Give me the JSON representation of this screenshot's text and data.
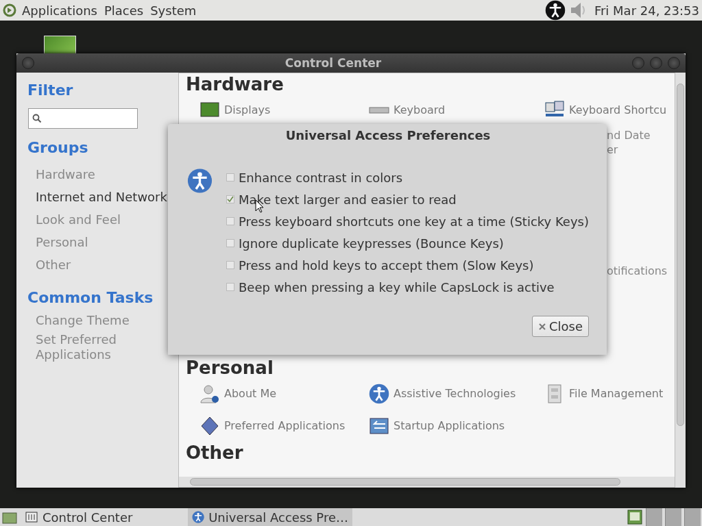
{
  "top_panel": {
    "menus": [
      "Applications",
      "Places",
      "System"
    ],
    "clock": "Fri Mar 24, 23:53"
  },
  "window": {
    "title": "Control Center"
  },
  "sidebar": {
    "filter_heading": "Filter",
    "groups_heading": "Groups",
    "groups": [
      {
        "label": "Hardware",
        "selected": false
      },
      {
        "label": "Internet and Network",
        "selected": true
      },
      {
        "label": "Look and Feel",
        "selected": false
      },
      {
        "label": "Personal",
        "selected": false
      },
      {
        "label": "Other",
        "selected": false
      }
    ],
    "tasks_heading": "Common Tasks",
    "tasks": [
      "Change Theme",
      "Set Preferred Applications"
    ]
  },
  "content": {
    "sections": [
      {
        "title": "Hardware",
        "items": [
          {
            "label": "Displays",
            "kind": "display"
          },
          {
            "label": "Keyboard",
            "kind": "keyboard"
          },
          {
            "label": "Keyboard Shortcu",
            "kind": "shortcuts"
          }
        ],
        "partly_hidden": [
          [
            "nd Date",
            "er"
          ],
          [
            "otifications"
          ]
        ]
      },
      {
        "title": "Personal",
        "items": [
          {
            "label": "About Me",
            "kind": "person"
          },
          {
            "label": "Assistive Technologies",
            "kind": "access"
          },
          {
            "label": "File Management",
            "kind": "cabinet"
          },
          {
            "label": "Preferred Applications",
            "kind": "diamond"
          },
          {
            "label": "Startup Applications",
            "kind": "startup"
          }
        ]
      },
      {
        "title": "Other"
      }
    ]
  },
  "dialog": {
    "title": "Universal Access Preferences",
    "options": [
      {
        "label": "Enhance contrast in colors",
        "checked": false
      },
      {
        "label": "Make text larger and easier to read",
        "checked": true
      },
      {
        "label": "Press keyboard shortcuts one key at a time (Sticky Keys)",
        "checked": false
      },
      {
        "label": "Ignore duplicate keypresses (Bounce Keys)",
        "checked": false
      },
      {
        "label": "Press and hold keys to accept them (Slow Keys)",
        "checked": false
      },
      {
        "label": "Beep when pressing a key while CapsLock is active",
        "checked": false
      }
    ],
    "close_button": "Close"
  },
  "taskbar": {
    "tasks": [
      {
        "label": "Control Center",
        "selected": false,
        "kind": "settings"
      },
      {
        "label": "Universal Access Pre…",
        "selected": true,
        "kind": "access"
      }
    ]
  }
}
